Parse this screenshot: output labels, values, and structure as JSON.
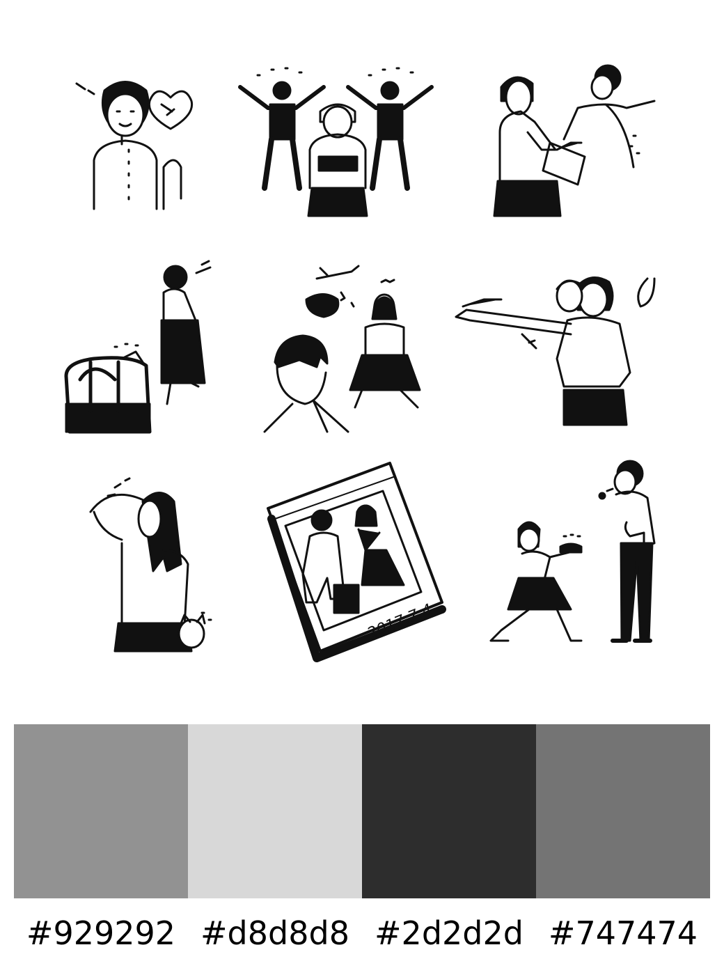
{
  "illustration_sheet": {
    "cells": [
      {
        "icon": "woman-with-heart-balloon-icon"
      },
      {
        "icon": "celebrating-figures-with-gift-icon"
      },
      {
        "icon": "woman-handing-box-to-child-icon"
      },
      {
        "icon": "woman-with-travel-bag-icon"
      },
      {
        "icon": "man-and-woman-thinking-of-travel-icon"
      },
      {
        "icon": "woman-eating-banana-icon"
      },
      {
        "icon": "surprised-woman-with-cat-icon"
      },
      {
        "icon": "couple-photo-frame-icon"
      },
      {
        "icon": "proposal-kneeling-woman-icon"
      }
    ],
    "photo_caption": "2017.7.4"
  },
  "palette": {
    "swatches": [
      {
        "color": "#929292",
        "label": "#929292"
      },
      {
        "color": "#d8d8d8",
        "label": "#d8d8d8"
      },
      {
        "color": "#2d2d2d",
        "label": "#2d2d2d"
      },
      {
        "color": "#747474",
        "label": "#747474"
      }
    ]
  }
}
